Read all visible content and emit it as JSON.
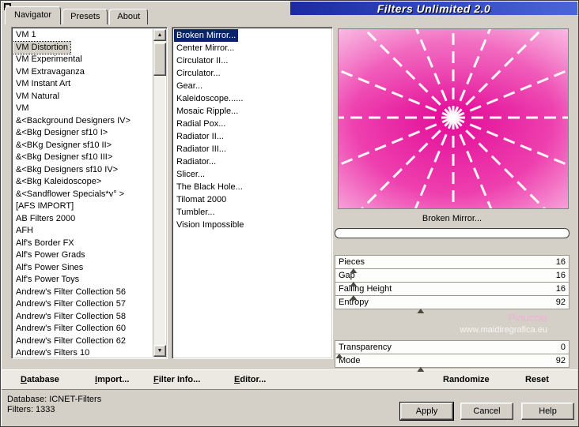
{
  "window": {
    "title": "Filters Unlimited 2.0"
  },
  "tabs": [
    {
      "label": "Navigator",
      "active": true
    },
    {
      "label": "Presets",
      "active": false
    },
    {
      "label": "About",
      "active": false
    }
  ],
  "categories": {
    "selected": "VM Distortion",
    "items": [
      "VM 1",
      "VM Distortion",
      "VM Experimental",
      "VM Extravaganza",
      "VM Instant Art",
      "VM Natural",
      "VM",
      "&<Background Designers IV>",
      "&<Bkg Designer sf10 I>",
      "&<BKg Designer sf10 II>",
      "&<Bkg Designer sf10 III>",
      "&<Bkg Designers sf10 IV>",
      "&<Bkg Kaleidoscope>",
      "&<Sandflower Specials*v° >",
      "[AFS IMPORT]",
      "AB Filters 2000",
      "AFH",
      "Alf's Border FX",
      "Alf's Power Grads",
      "Alf's Power Sines",
      "Alf's Power Toys",
      "Andrew's Filter Collection 56",
      "Andrew's Filter Collection 57",
      "Andrew's Filter Collection 58",
      "Andrew's Filter Collection 60",
      "Andrew's Filter Collection 62",
      "Andrew's Filters 10"
    ]
  },
  "filters": {
    "selected": "Broken Mirror...",
    "items": [
      "Broken Mirror...",
      "Center Mirror...",
      "Circulator II...",
      "Circulator...",
      "Gear...",
      "Kaleidoscope......",
      "Mosaic Ripple...",
      "Radial Pox...",
      "Radiator II...",
      "Radiator III...",
      "Radiator...",
      "Slicer...",
      "The Black Hole...",
      "Tilomat 2000",
      "Tumbler...",
      "Vision Impossible"
    ]
  },
  "preview": {
    "label": "Broken Mirror...",
    "rays": 16,
    "colors": {
      "center": "#e20c98",
      "mid": "#ee3fae",
      "edge": "#f9b7e2"
    }
  },
  "params_top": [
    {
      "label": "Pieces",
      "value": 16
    },
    {
      "label": "Gap",
      "value": 16
    },
    {
      "label": "Falling Height",
      "value": 16
    },
    {
      "label": "Entropy",
      "value": 92
    }
  ],
  "params_bottom": [
    {
      "label": "Transparency",
      "value": 0
    },
    {
      "label": "Mode",
      "value": 92
    }
  ],
  "watermark": {
    "line1": "Pinuccia",
    "line2": "www.maidiregrafica.eu"
  },
  "toolbar": {
    "items": [
      {
        "name": "database-button",
        "label": "Database",
        "accel": true
      },
      {
        "name": "import-button",
        "label": "Import...",
        "accel": true
      },
      {
        "name": "filter-info-button",
        "label": "Filter Info...",
        "accel": true
      },
      {
        "name": "editor-button",
        "label": "Editor...",
        "accel": true
      },
      {
        "name": "randomize-button",
        "label": "Randomize",
        "accel": false
      },
      {
        "name": "reset-button",
        "label": "Reset",
        "accel": false
      }
    ]
  },
  "statusbar": {
    "line1": "Database: ICNET-Filters",
    "line2": "Filters: 1333"
  },
  "buttons": {
    "apply": "Apply",
    "cancel": "Cancel",
    "help": "Help"
  }
}
